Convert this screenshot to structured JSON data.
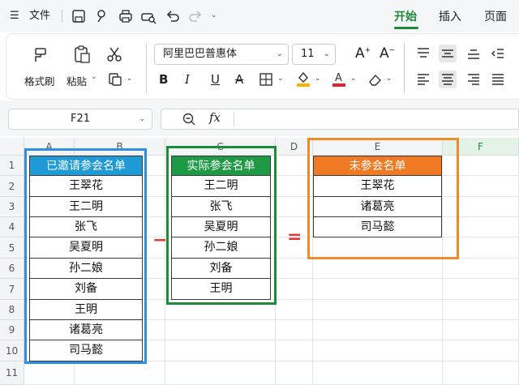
{
  "menu": {
    "hamburger": "☰",
    "file": "文件",
    "tabs": [
      "开始",
      "插入",
      "页面"
    ]
  },
  "ribbon": {
    "format_painter": "格式刷",
    "paste": "粘贴",
    "font_name": "阿里巴巴普惠体",
    "font_size": "11",
    "bold": "B",
    "italic": "I",
    "underline": "U",
    "strike": "A"
  },
  "formula_bar": {
    "cell_ref": "F21",
    "fx": "fx"
  },
  "columns": [
    "A",
    "B",
    "C",
    "D",
    "E",
    "F"
  ],
  "rows": [
    "1",
    "2",
    "3",
    "4",
    "5",
    "6",
    "7",
    "8",
    "9",
    "10",
    "11"
  ],
  "tables": {
    "invited": {
      "header": "已邀请参会名单",
      "header_color": "#1e9bd7",
      "frame_color": "#2d8ee8",
      "names": [
        "王翠花",
        "王二明",
        "张飞",
        "吴夏明",
        "孙二娘",
        "刘备",
        "王明",
        "诸葛亮",
        "司马懿"
      ]
    },
    "attended": {
      "header": "实际参会名单",
      "header_color": "#1e9a45",
      "frame_color": "#1f8a3a",
      "names": [
        "王二明",
        "张飞",
        "吴夏明",
        "孙二娘",
        "刘备",
        "王明"
      ]
    },
    "absent": {
      "header": "未参会名单",
      "header_color": "#f07a23",
      "frame_color": "#f08a2a",
      "names": [
        "王翠花",
        "诸葛亮",
        "司马懿"
      ]
    }
  },
  "operators": {
    "minus": "−",
    "equals": "="
  }
}
